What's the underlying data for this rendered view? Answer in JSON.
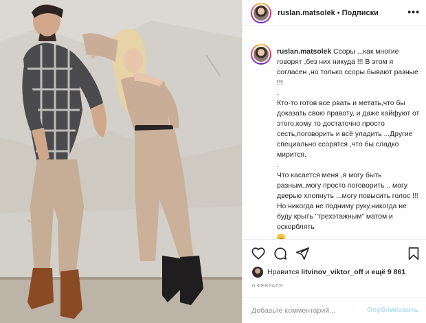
{
  "post": {
    "username": "ruslan.matsolek",
    "separator": "•",
    "follow_label": "Подписки",
    "more_label": "•••"
  },
  "caption": {
    "username": "ruslan.matsolek",
    "intro": "Ссоры ...как многие говорят ,без них никуда !!! В этом я согласен ,но только ссоры бывают разные !!!",
    "dot1": ".",
    "paragraph2": "Кто-то готов все рвать и метать,что бы доказать свою правоту, и даже кайфуют от этого,кому то достаточно просто сесть,поговорить и всё уладить ...Другие специально ссорятся ,что бы сладко мирится.",
    "dot2": ".",
    "paragraph3": "Что касается меня ,я могу быть разным..могу просто поговорить .. могу дверью хлопнуть ...могу повысить голос !!! Но никогда не подниму руку,никогда не буду крыть \"трехэтажным\" матом и оскорблять"
  },
  "likes": {
    "prefix": "Нравится",
    "liker": "litvinov_viktor_off",
    "and": "и",
    "others": "ещё 9 861"
  },
  "date": "6 ФЕВРАЛЯ",
  "comment": {
    "placeholder": "Добавьте комментарий...",
    "publish_label": "Опубликовать"
  },
  "colors": {
    "accent_disabled": "#b2dffc",
    "text": "#262626",
    "muted": "#8e8e8e",
    "divider": "#efefef"
  },
  "icons": [
    "heart-icon",
    "comment-icon",
    "share-icon",
    "bookmark-icon",
    "more-icon",
    "smile-emoji-icon"
  ]
}
